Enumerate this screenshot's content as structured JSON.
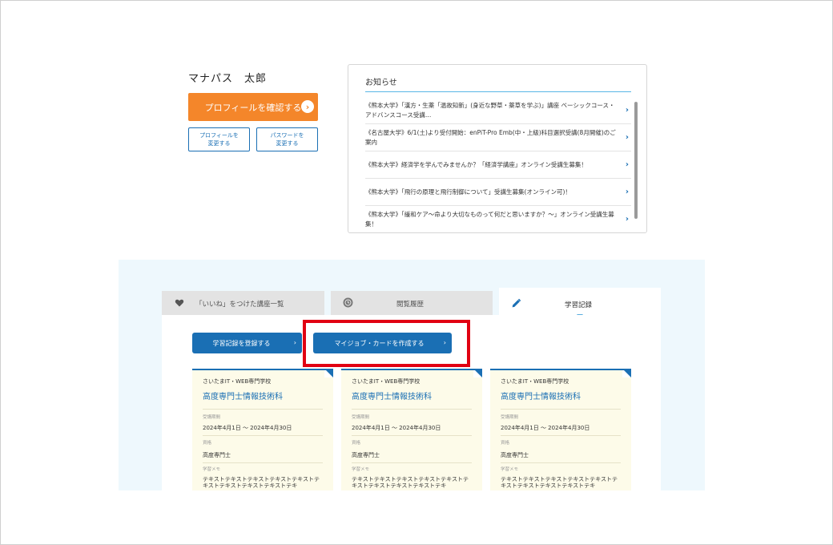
{
  "profile": {
    "name": "マナパス　太郎",
    "confirm_label": "プロフィールを確認する",
    "edit_profile_label": "プロフィールを\n変更する",
    "change_password_label": "パスワードを\n変更する"
  },
  "notices": {
    "title": "お知らせ",
    "items": [
      "《熊本大学》「漢方・生薬「温故知新」(身近な野草・薬草を学ぶ)」講座 ベーシックコース・アドバンスコース受講…",
      "《名古屋大学》6/1(土)より受付開始：enPiT-Pro Emb(中・上級)科目選択受講(8月開催)のご案内",
      "《熊本大学》経済学を学んでみませんか？「経済学講座」オンライン受講生募集！",
      "《熊本大学》「飛行の原理と飛行制御について」受講生募集(オンライン可)！",
      "《熊本大学》「緩和ケア～命より大切なものって何だと思いますか？～」オンライン受講生募集！"
    ]
  },
  "tabs": {
    "likes": "「いいね」をつけた講座一覧",
    "history": "閲覧履歴",
    "records": "学習記録"
  },
  "actions": {
    "register_record": "学習記録を登録する",
    "create_card": "マイジョブ・カードを作成する"
  },
  "cards": [
    {
      "school": "さいたまIT・WEB専門学校",
      "course": "高度専門士情報技術科",
      "period_label": "受講期間",
      "period": "2024年4月1日 ～ 2024年4月30日",
      "qualification_label": "資格",
      "qualification": "高度専門士",
      "memo_label": "学習メモ",
      "memo": "テキストテキストテキストテキストテキストテキストテキストテキストテキストテキ"
    },
    {
      "school": "さいたまIT・WEB専門学校",
      "course": "高度専門士情報技術科",
      "period_label": "受講期間",
      "period": "2024年4月1日 ～ 2024年4月30日",
      "qualification_label": "資格",
      "qualification": "高度専門士",
      "memo_label": "学習メモ",
      "memo": "テキストテキストテキストテキストテキストテキストテキストテキストテキストテキ"
    },
    {
      "school": "さいたまIT・WEB専門学校",
      "course": "高度専門士情報技術科",
      "period_label": "受講期間",
      "period": "2024年4月1日 ～ 2024年4月30日",
      "qualification_label": "資格",
      "qualification": "高度専門士",
      "memo_label": "学習メモ",
      "memo": "テキストテキストテキストテキストテキストテキストテキストテキストテキストテキ"
    }
  ],
  "colors": {
    "accent_orange": "#f4862a",
    "primary_blue": "#1a6fb4",
    "highlight_red": "#e10012",
    "panel_bg": "#eef8fd",
    "card_bg": "#fdfbe9"
  }
}
